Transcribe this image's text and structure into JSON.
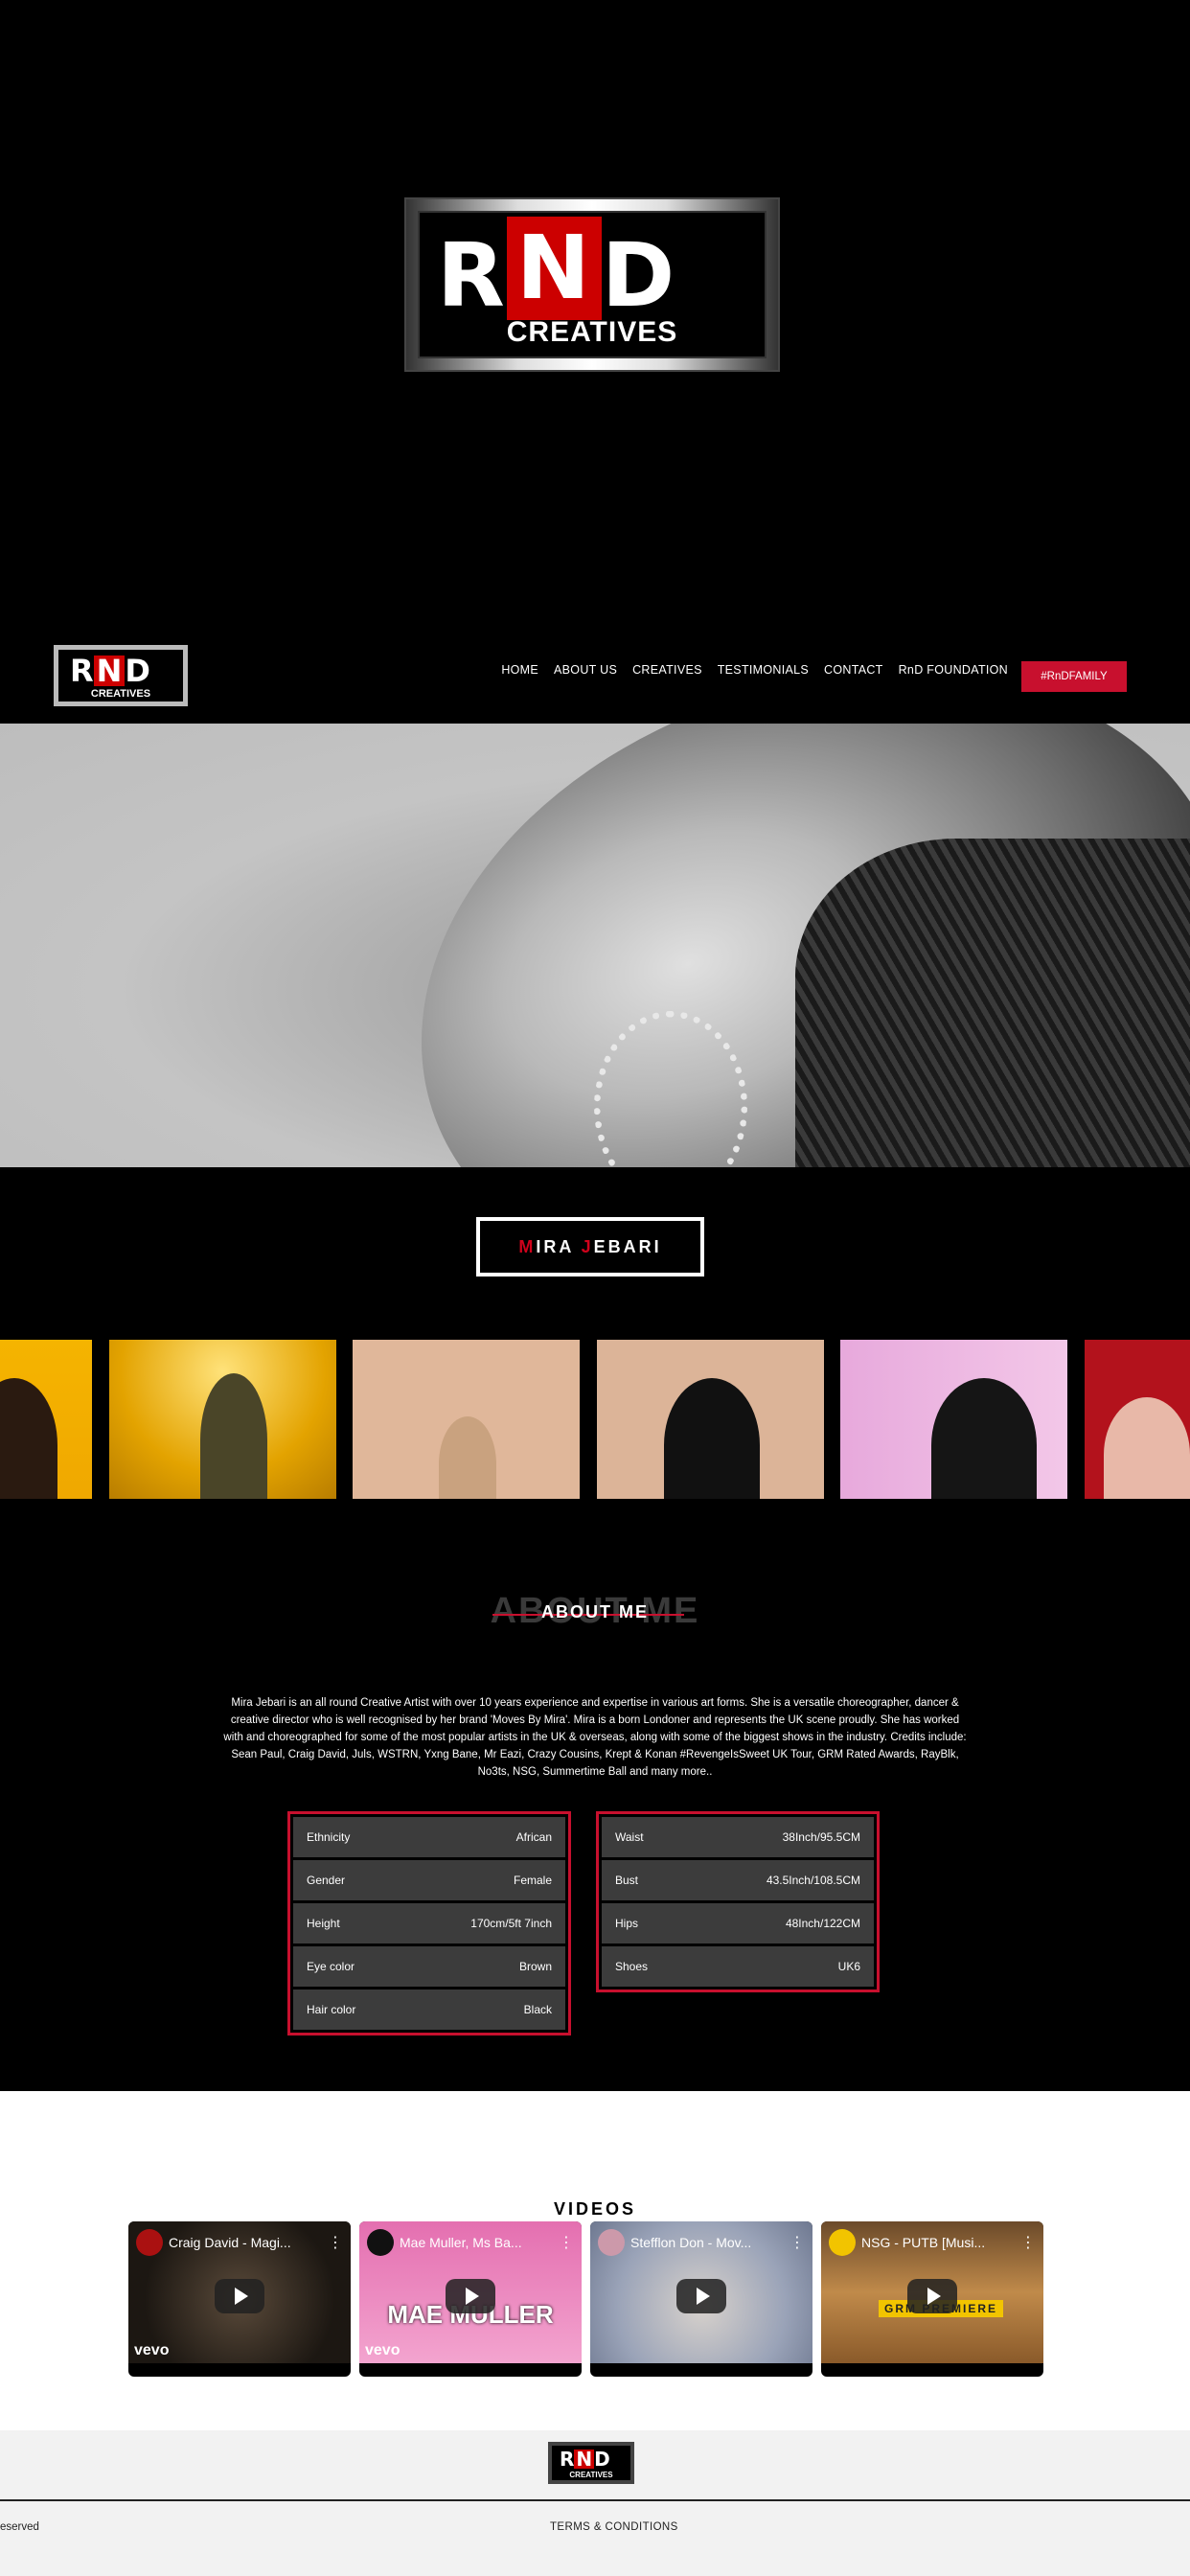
{
  "brand": {
    "letters": [
      "R",
      "N",
      "D"
    ],
    "sub": "CREATIVES"
  },
  "nav": {
    "items": [
      "HOME",
      "ABOUT US",
      "CREATIVES",
      "TESTIMONIALS",
      "CONTACT",
      "RnD FOUNDATION"
    ],
    "cta": "#RnDFAMILY"
  },
  "profile": {
    "first_initial": "M",
    "first_rest": "IRA ",
    "last_initial": "J",
    "last_rest": "EBARI"
  },
  "about": {
    "bg_text": "ABOUT ME",
    "title": "ABOUT ME",
    "text": "Mira Jebari is an all round Creative Artist with over 10 years experience and expertise in various art forms. She is a versatile choreographer, dancer & creative director who is well recognised by her brand 'Moves By Mira'. Mira is a born Londoner and represents the UK scene proudly. She has worked with and choreographed for some of the most popular artists in the UK & overseas, along with some of the biggest shows in the industry. Credits include: Sean Paul, Craig David, Juls, WSTRN, Yxng Bane, Mr Eazi, Crazy Cousins, Krept & Konan #RevengeIsSweet UK Tour, GRM Rated Awards, RayBlk, No3ts, NSG, Summertime Ball and many more.."
  },
  "specs_left": [
    {
      "label": "Ethnicity",
      "value": "African"
    },
    {
      "label": "Gender",
      "value": "Female"
    },
    {
      "label": "Height",
      "value": "170cm/5ft 7inch"
    },
    {
      "label": "Eye color",
      "value": "Brown"
    },
    {
      "label": "Hair color",
      "value": "Black"
    }
  ],
  "specs_right": [
    {
      "label": "Waist",
      "value": "38Inch/95.5CM"
    },
    {
      "label": "Bust",
      "value": "43.5Inch/108.5CM"
    },
    {
      "label": "Hips",
      "value": "48Inch/122CM"
    },
    {
      "label": "Shoes",
      "value": "UK6"
    }
  ],
  "videos": {
    "title": "VIDEOS",
    "items": [
      {
        "title": "Craig David - Magi...",
        "badge": "vevo"
      },
      {
        "title": "Mae Muller, Ms Ba...",
        "badge": "vevo",
        "caption": "MAE MULLER"
      },
      {
        "title": "Stefflon Don - Mov...",
        "badge": ""
      },
      {
        "title": "NSG - PUTB [Musi...",
        "badge": "",
        "caption": "GRM PREMIERE"
      }
    ]
  },
  "footer": {
    "rights": "eserved",
    "terms": "TERMS & CONDITIONS"
  },
  "colors": {
    "accent": "#c8102e",
    "panel": "#3c3c3c",
    "background": "#000000"
  }
}
